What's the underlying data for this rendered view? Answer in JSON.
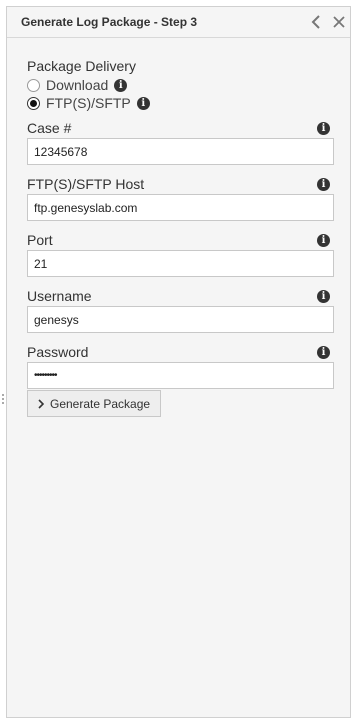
{
  "header": {
    "title": "Generate Log Package - Step 3"
  },
  "delivery": {
    "label": "Package Delivery",
    "options": [
      {
        "label": "Download",
        "selected": false
      },
      {
        "label": "FTP(S)/SFTP",
        "selected": true
      }
    ]
  },
  "fields": {
    "case": {
      "label": "Case #",
      "value": "12345678"
    },
    "host": {
      "label": "FTP(S)/SFTP Host",
      "value": "ftp.genesyslab.com"
    },
    "port": {
      "label": "Port",
      "value": "21"
    },
    "username": {
      "label": "Username",
      "value": "genesys"
    },
    "password": {
      "label": "Password",
      "value": "•••••••••"
    }
  },
  "actions": {
    "generate_label": "Generate Package"
  },
  "icons": {
    "info": "info-icon",
    "back": "chevron-left-icon",
    "close": "close-icon",
    "button": "chevron-right-icon"
  }
}
